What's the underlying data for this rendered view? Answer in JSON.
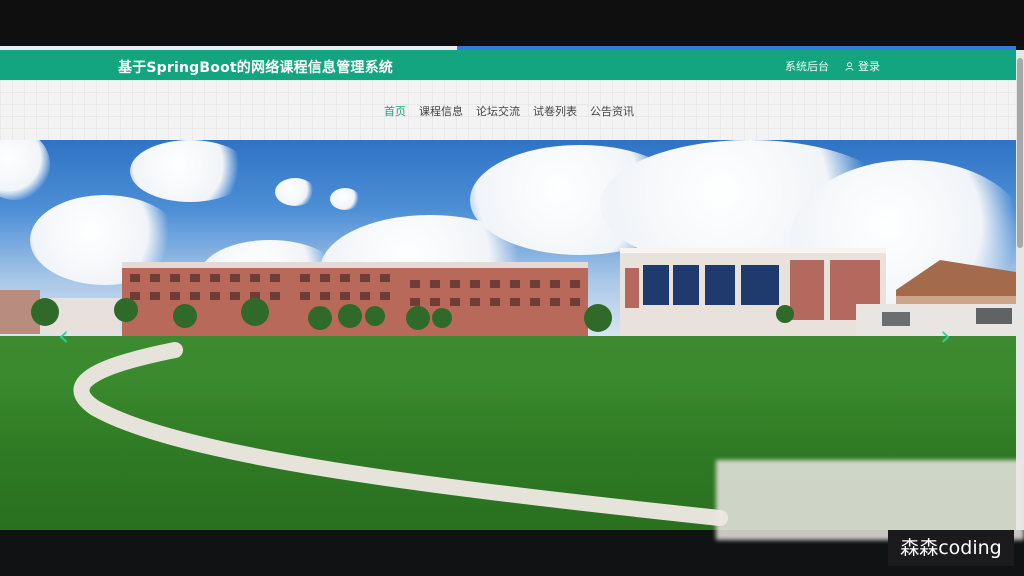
{
  "site": {
    "title": "基于SpringBoot的网络课程信息管理系统",
    "admin_label": "系统后台",
    "login_label": "登录"
  },
  "nav": {
    "items": [
      {
        "label": "首页",
        "active": true
      },
      {
        "label": "课程信息",
        "active": false
      },
      {
        "label": "论坛交流",
        "active": false
      },
      {
        "label": "试卷列表",
        "active": false
      },
      {
        "label": "公告资讯",
        "active": false
      }
    ]
  },
  "banner": {
    "prev_symbol": "‹",
    "next_symbol": "›"
  },
  "overlay": {
    "watermark": "森森coding"
  },
  "colors": {
    "brand_green": "#12a57f",
    "nav_active": "#12a57f"
  }
}
